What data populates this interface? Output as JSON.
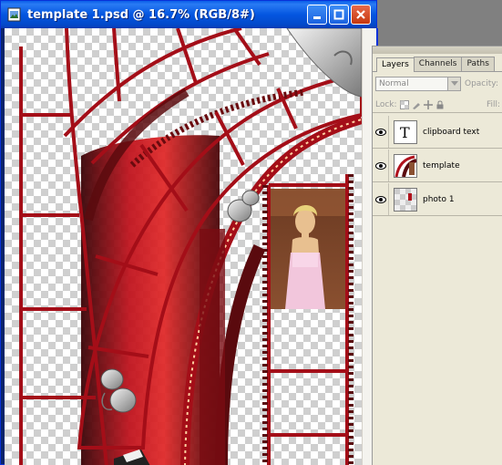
{
  "window": {
    "title": "template 1.psd @ 16.7% (RGB/8#)",
    "buttons": {
      "minimize": "minimize",
      "maximize": "maximize",
      "close": "close"
    }
  },
  "palette": {
    "tabs": [
      {
        "label": "Layers",
        "active": true
      },
      {
        "label": "Channels",
        "active": false
      },
      {
        "label": "Paths",
        "active": false
      }
    ],
    "blend_mode": "Normal",
    "opacity_label": "Opacity:",
    "lock_label": "Lock:",
    "fill_label": "Fill:",
    "layers": [
      {
        "name": "clipboard text",
        "thumb": "text-layer-icon",
        "visible": true
      },
      {
        "name": "template",
        "thumb": "template-thumbnail",
        "visible": true
      },
      {
        "name": "photo 1",
        "thumb": "photo-thumbnail",
        "visible": true
      }
    ]
  },
  "colors": {
    "titlebar": "#0456e0",
    "film_red": "#b0121c",
    "film_dark": "#5a0a0e",
    "checker": "#cfcfcf"
  }
}
